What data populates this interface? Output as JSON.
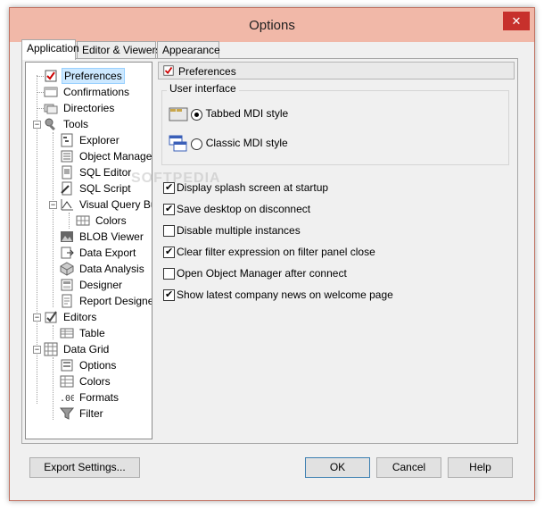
{
  "window": {
    "title": "Options",
    "close": "✕"
  },
  "tabs": [
    {
      "label": "Application"
    },
    {
      "label": "Editor & Viewers"
    },
    {
      "label": "Appearance"
    }
  ],
  "tree": [
    {
      "label": "Preferences"
    },
    {
      "label": "Confirmations"
    },
    {
      "label": "Directories"
    },
    {
      "label": "Tools"
    },
    {
      "label": "Explorer"
    },
    {
      "label": "Object Manager"
    },
    {
      "label": "SQL Editor"
    },
    {
      "label": "SQL Script"
    },
    {
      "label": "Visual Query Builder"
    },
    {
      "label": "Colors"
    },
    {
      "label": "BLOB Viewer"
    },
    {
      "label": "Data Export"
    },
    {
      "label": "Data Analysis"
    },
    {
      "label": "Designer"
    },
    {
      "label": "Report Designer"
    },
    {
      "label": "Editors"
    },
    {
      "label": "Table"
    },
    {
      "label": "Data Grid"
    },
    {
      "label": "Options"
    },
    {
      "label": "Colors"
    },
    {
      "label": "Formats"
    },
    {
      "label": "Filter"
    }
  ],
  "panel": {
    "header": "Preferences",
    "group_label": "User interface",
    "radios": [
      {
        "label": "Tabbed MDI style",
        "checked": true
      },
      {
        "label": "Classic MDI style",
        "checked": false
      }
    ],
    "checks": [
      {
        "label": "Display splash screen at startup",
        "checked": true
      },
      {
        "label": "Save desktop on disconnect",
        "checked": true
      },
      {
        "label": "Disable multiple instances",
        "checked": false
      },
      {
        "label": "Clear filter expression on filter panel close",
        "checked": true
      },
      {
        "label": "Open Object Manager after connect",
        "checked": false
      },
      {
        "label": "Show latest company news on welcome page",
        "checked": true
      }
    ]
  },
  "buttons": {
    "export": "Export Settings...",
    "ok": "OK",
    "cancel": "Cancel",
    "help": "Help"
  },
  "watermark": "SOFTPEDIA"
}
